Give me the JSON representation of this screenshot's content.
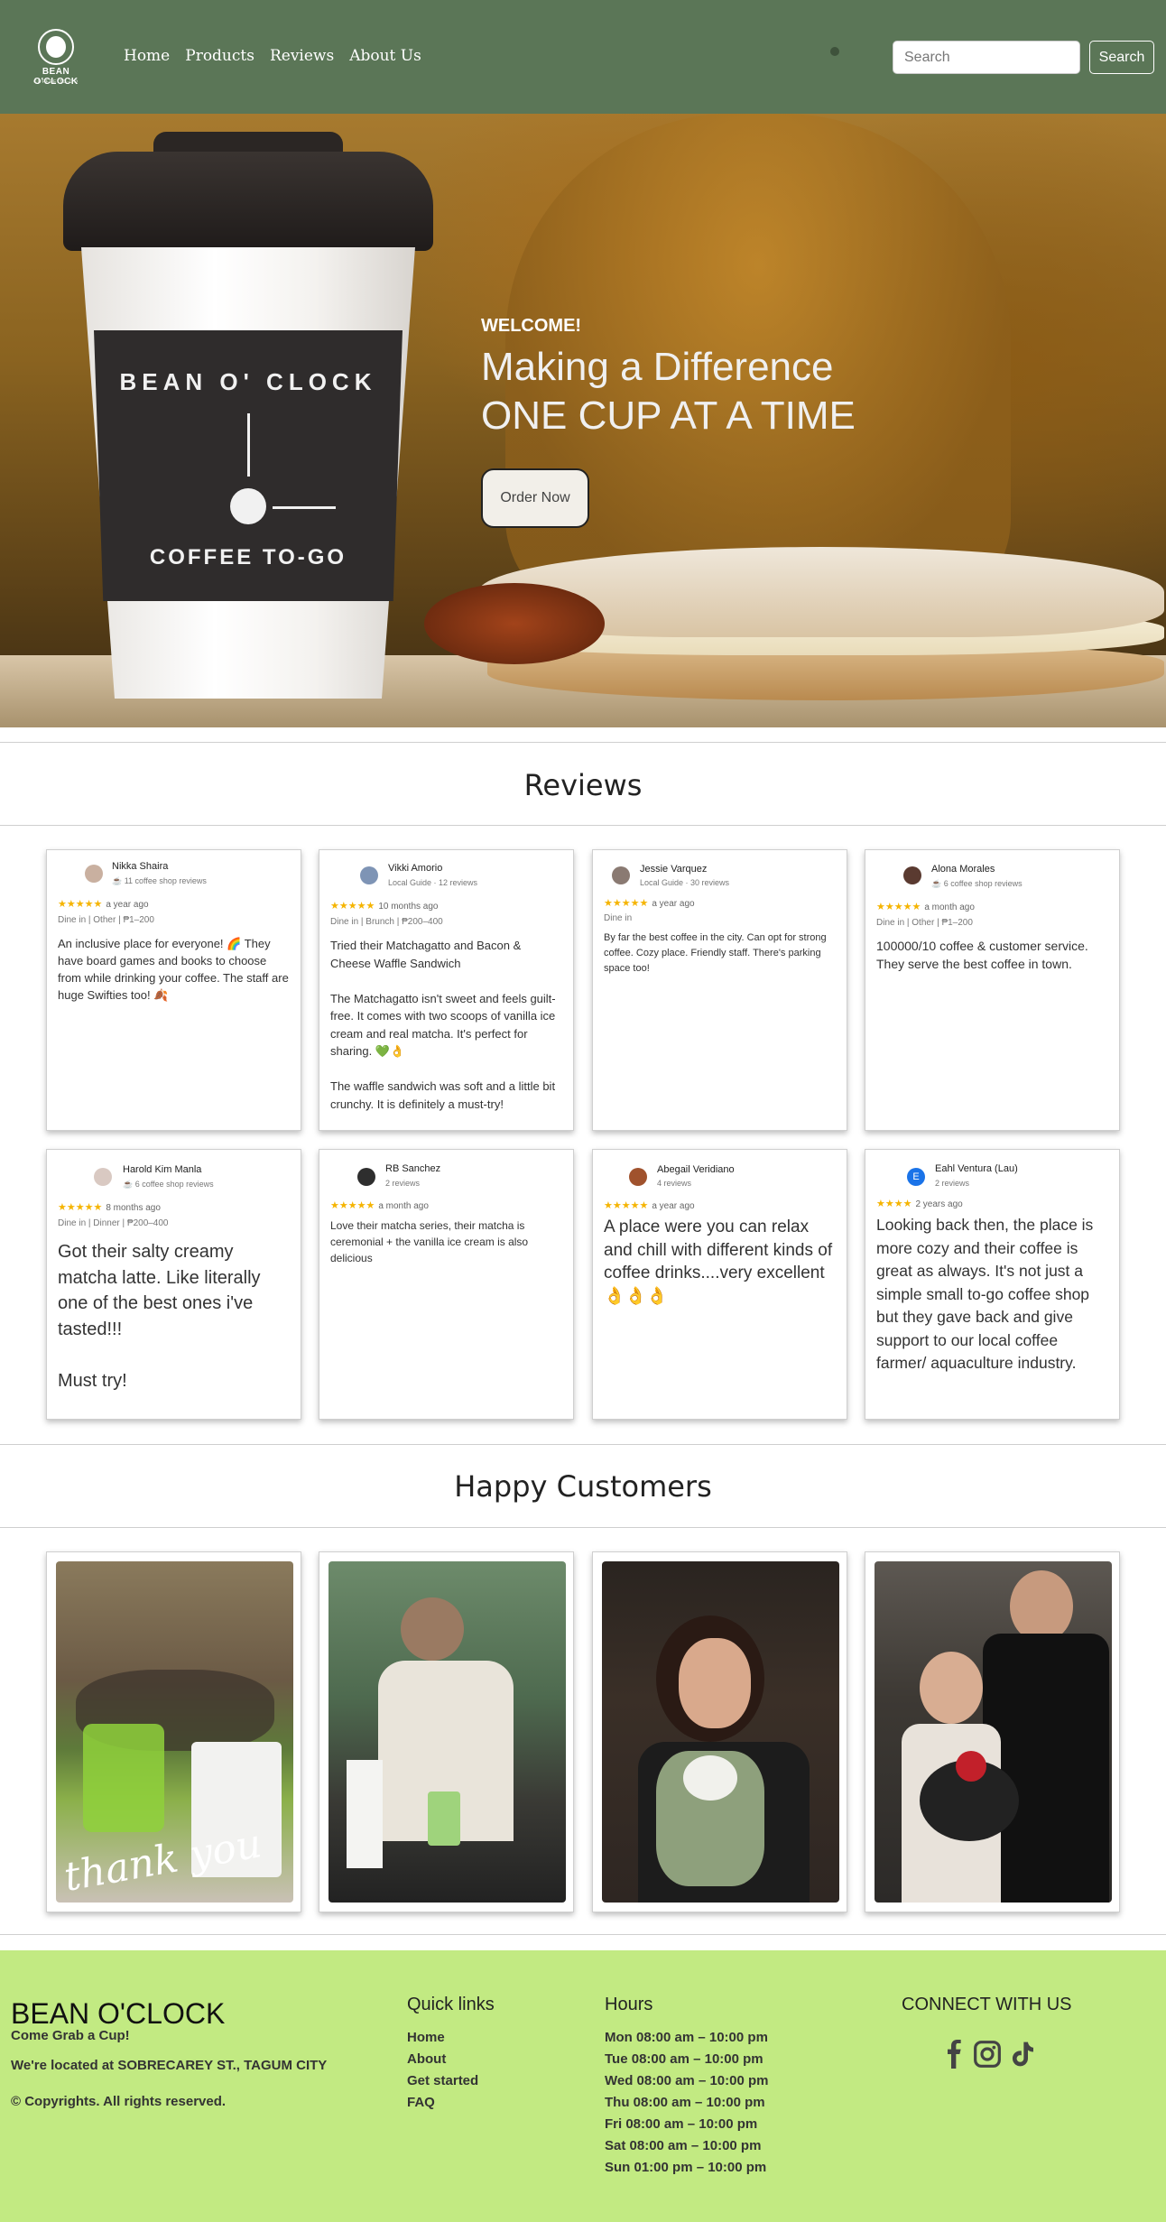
{
  "nav": {
    "logo_name": "BEAN O'CLOCK",
    "logo_sub": "COFFEE TO-GO",
    "links": [
      "Home",
      "Products",
      "Reviews",
      "About Us"
    ],
    "search_placeholder": "Search",
    "search_button": "Search"
  },
  "hero": {
    "welcome": "WELCOME!",
    "title_line1": "Making a Difference",
    "title_line2": "ONE CUP AT A TIME",
    "button": "Order Now",
    "cup_brand": "BEAN O' CLOCK",
    "cup_tagline": "COFFEE TO-GO"
  },
  "reviews": {
    "title": "Reviews",
    "items": [
      {
        "name": "Nikka Shaira",
        "meta": "☕ 11 coffee shop reviews",
        "stars": "★★★★★",
        "when": "a year ago",
        "tags": "Dine in | Other | ₱1–200",
        "text": "An inclusive place for everyone! 🌈 They have board games and books to choose from while drinking your coffee. The staff are huge Swifties too! 🍂"
      },
      {
        "name": "Vikki Amorio",
        "meta": "Local Guide · 12 reviews",
        "stars": "★★★★★",
        "when": "10 months ago",
        "tags": "Dine in | Brunch | ₱200–400",
        "text": "Tried their Matchagatto and  Bacon & Cheese Waffle Sandwich\n\nThe Matchagatto isn't sweet and feels guilt-free. It comes with two scoops of vanilla ice cream and real matcha. It's perfect for sharing. 💚👌\n\nThe waffle sandwich was soft and a little bit crunchy. It is definitely a must-try!"
      },
      {
        "name": "Jessie Varquez",
        "meta": "Local Guide · 30 reviews",
        "stars": "★★★★★",
        "when": "a year ago",
        "tags": "Dine in",
        "text": "By far the best coffee in the city. Can opt for strong coffee. Cozy place. Friendly staff. There's parking space too!"
      },
      {
        "name": "Alona Morales",
        "meta": "☕ 6 coffee shop reviews",
        "stars": "★★★★★",
        "when": "a month ago",
        "tags": "Dine in | Other | ₱1–200",
        "text": "100000/10 coffee & customer service. They serve the best coffee in town."
      },
      {
        "name": "Harold Kim Manla",
        "meta": "☕ 6 coffee shop reviews",
        "stars": "★★★★★",
        "when": "8 months ago",
        "tags": "Dine in | Dinner | ₱200–400",
        "text": "Got their salty creamy matcha latte. Like literally one of the best ones i've tasted!!!\n\nMust try!"
      },
      {
        "name": "RB Sanchez",
        "meta": "2 reviews",
        "stars": "★★★★★",
        "when": "a month ago",
        "tags": "",
        "text": "Love their matcha series, their matcha is ceremonial + the vanilla ice cream is also delicious"
      },
      {
        "name": "Abegail Veridiano",
        "meta": "4 reviews",
        "stars": "★★★★★",
        "when": "a year ago",
        "tags": "",
        "text": "A place were you can relax and chill with different kinds of coffee drinks....very excellent 👌👌👌"
      },
      {
        "name": "Eahl Ventura (Lau)",
        "meta": "2 reviews",
        "stars": "★★★★",
        "when": "2 years ago",
        "tags": "",
        "avatar_letter": "E",
        "text": "Looking back then, the place is more cozy and their coffee is great as always. It's not just a simple small to-go coffee shop but they gave back and give support to our local coffee farmer/ aquaculture industry."
      }
    ]
  },
  "customers": {
    "title": "Happy Customers",
    "photo_caption": "thank you"
  },
  "footer": {
    "brand": "BEAN O'CLOCK",
    "tagline": "Come Grab a Cup!",
    "location": "We're located at SOBRECAREY ST., TAGUM CITY",
    "copyright": "© Copyrights. All rights reserved.",
    "quick_links_title": "Quick links",
    "quick_links": [
      "Home",
      "About",
      "Get started",
      "FAQ"
    ],
    "hours_title": "Hours",
    "hours": [
      "Mon 08:00 am – 10:00 pm",
      "Tue 08:00 am – 10:00 pm",
      "Wed 08:00 am – 10:00 pm",
      "Thu 08:00 am – 10:00 pm",
      "Fri 08:00 am – 10:00 pm",
      "Sat 08:00 am – 10:00 pm",
      "Sun 01:00 pm – 10:00 pm"
    ],
    "connect_title": "CONNECT WITH US",
    "social_icons": [
      "facebook-icon",
      "instagram-icon",
      "tiktok-icon"
    ]
  },
  "colors": {
    "nav_bg": "#5b7657",
    "footer_bg": "#c2ea82",
    "star": "#f5b400"
  }
}
